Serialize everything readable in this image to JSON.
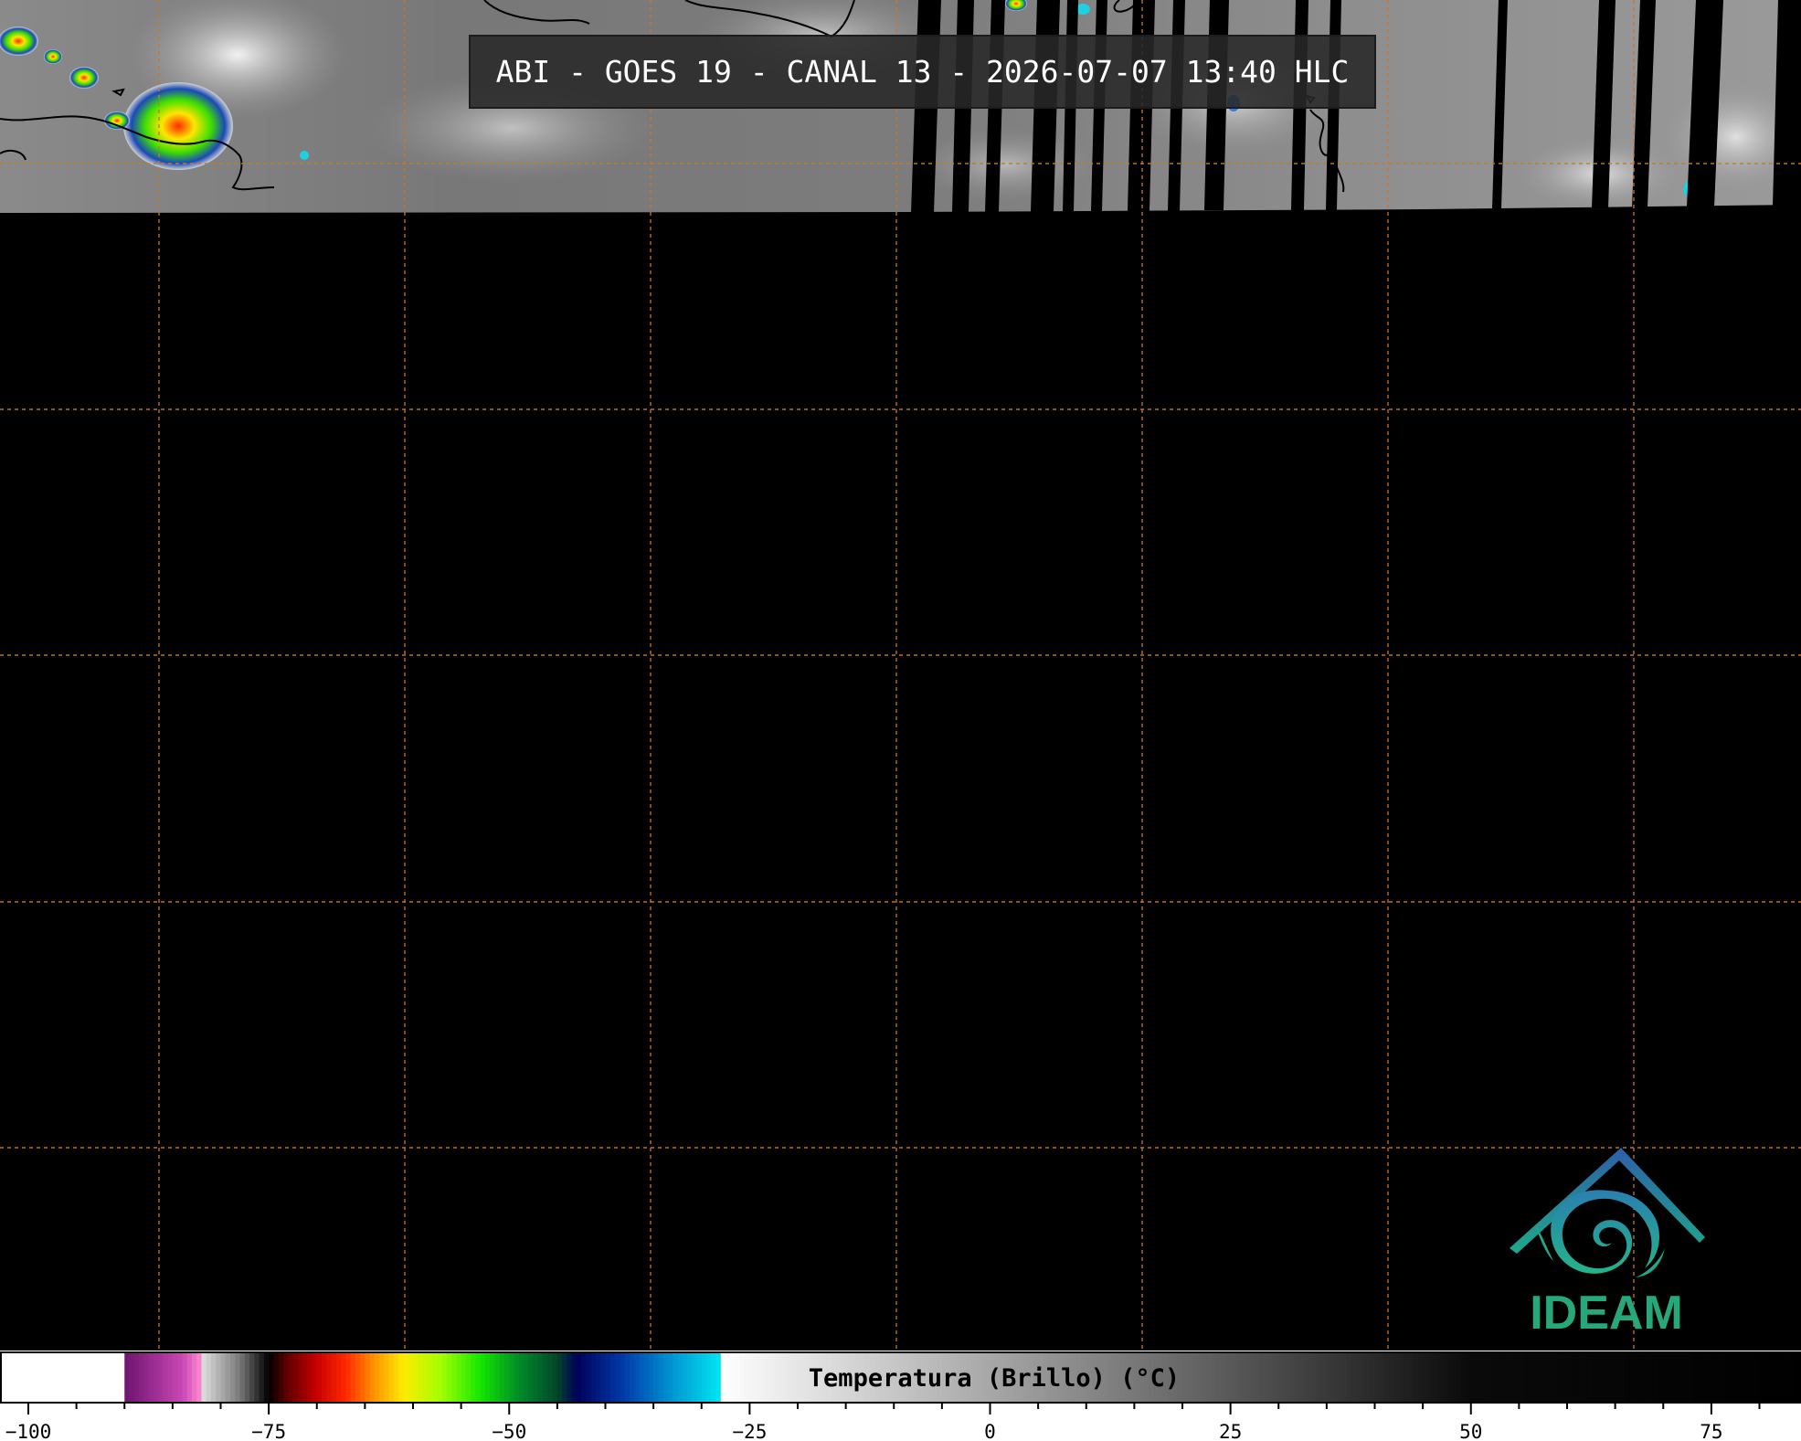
{
  "title": "ABI - GOES 19 - CANAL 13 - 2026-07-07 13:40 HLC",
  "logo": {
    "text": "IDEAM",
    "icon": "ideam-logo-icon",
    "color": "#26a87c"
  },
  "colorbar": {
    "label": "Temperatura (Brillo) (°C)",
    "unit": "°C",
    "min": -100,
    "max": 85,
    "ticks": [
      {
        "value": -100,
        "label": "−100"
      },
      {
        "value": -75,
        "label": "−75"
      },
      {
        "value": -50,
        "label": "−50"
      },
      {
        "value": -25,
        "label": "−25"
      },
      {
        "value": 0,
        "label": "0"
      },
      {
        "value": 25,
        "label": "25"
      },
      {
        "value": 50,
        "label": "50"
      },
      {
        "value": 75,
        "label": "75"
      }
    ]
  },
  "map": {
    "background": "#000000",
    "gridline_color": "#c8782e",
    "coastline_color": "#000000",
    "satellite_swath_visible": "top strip only",
    "missing_data": "black"
  }
}
